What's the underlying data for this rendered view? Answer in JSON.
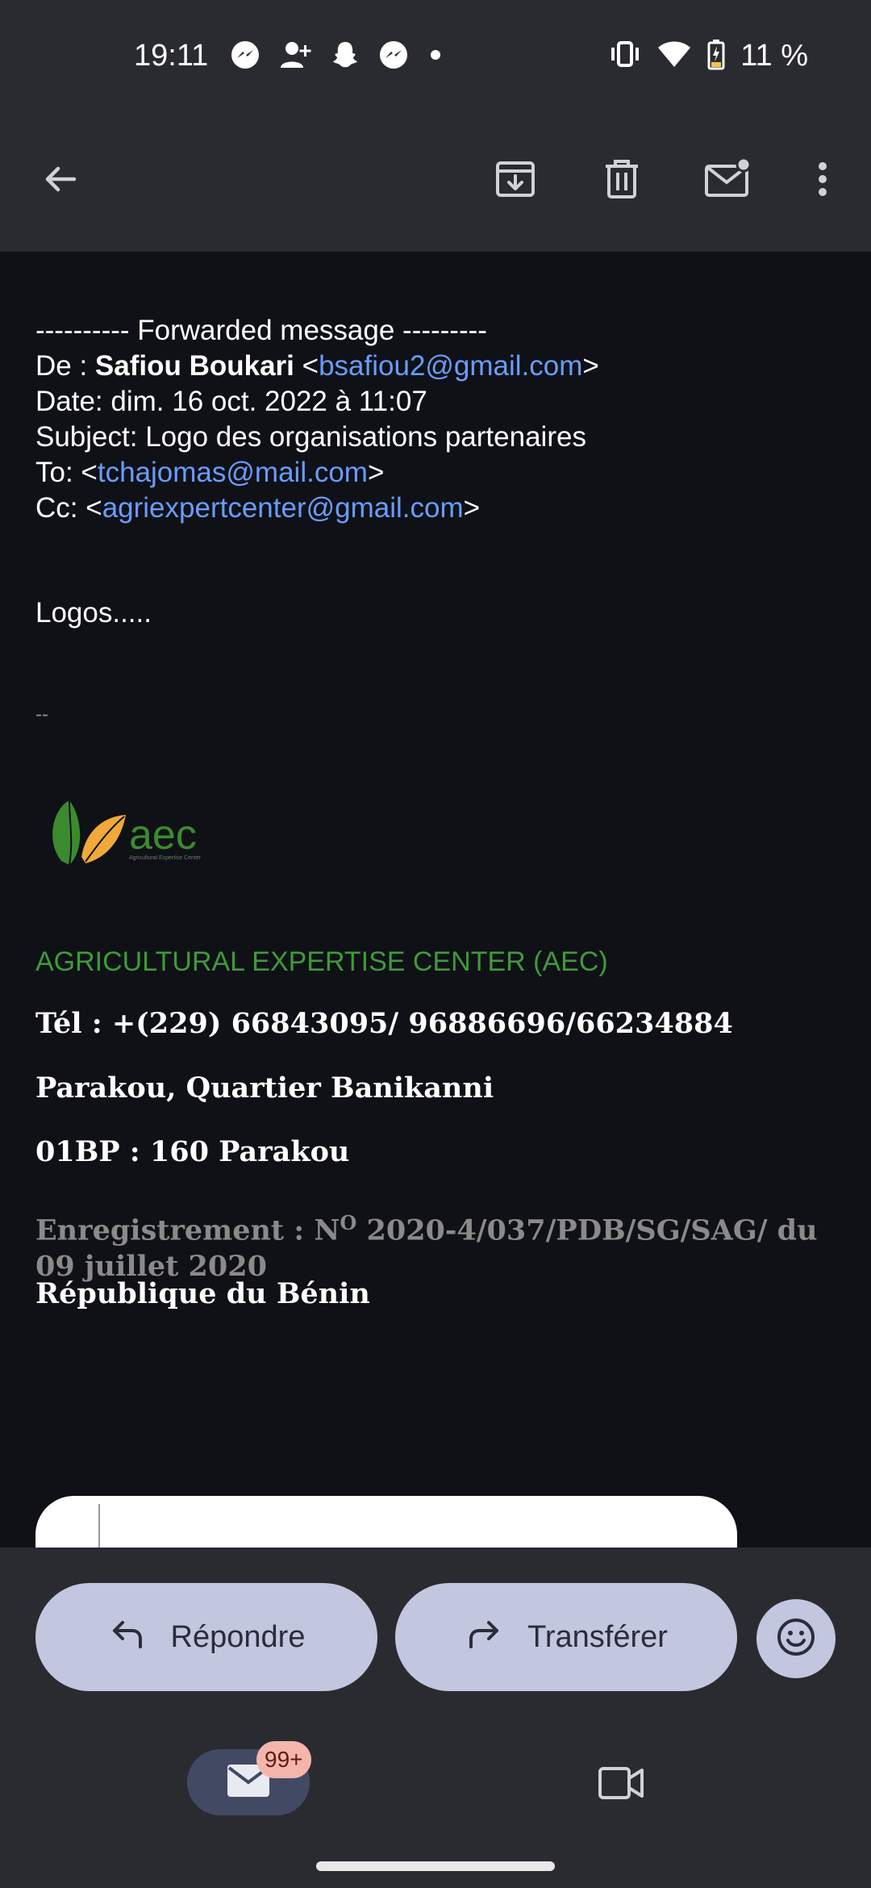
{
  "status_bar": {
    "time": "19:11",
    "battery_text": "11 %",
    "left_icons": [
      "messenger-icon",
      "add-person-icon",
      "snapchat-icon",
      "messenger-icon",
      "dot-icon"
    ],
    "right_icons": [
      "vibrate-icon",
      "wifi-icon",
      "battery-charging-icon"
    ]
  },
  "app_bar": {
    "icons": [
      "back-arrow-icon",
      "archive-icon",
      "delete-icon",
      "mark-unread-icon",
      "more-vert-icon"
    ]
  },
  "email": {
    "forward_header": "---------- Forwarded message ---------",
    "from_label": "De : ",
    "from_name": "Safiou Boukari",
    "from_email": "bsafiou2@gmail.com",
    "date_line": "Date: dim. 16 oct. 2022 à 11:07",
    "subject_line": "Subject: Logo des organisations partenaires",
    "to_label": "To: ",
    "to_email": "tchajomas@mail.com",
    "cc_label": "Cc: ",
    "cc_email": "agriexpertcenter@gmail.com",
    "body_text": "Logos.....",
    "signature_separator": "--",
    "logo": {
      "text": "aec",
      "subtext": "Agricultural Expertise Center"
    },
    "org_name": "AGRICULTURAL EXPERTISE CENTER (AEC)",
    "phone": "Tél : +(229) 66843095/ 96886696/66234884",
    "address": "Parakou, Quartier Banikanni",
    "bp": "01BP : 160 Parakou",
    "registration_prefix": "Enregistrement : N",
    "registration_sup": "O",
    "registration_rest": " 2020-4/037/PDB/SG/SAG/ du 09 juillet 2020",
    "country": "République du Bénin"
  },
  "actions": {
    "reply_label": "Répondre",
    "forward_label": "Transférer"
  },
  "bottom_nav": {
    "mail_badge": "99+"
  },
  "colors": {
    "link": "#6a9cff",
    "org_green": "#3f9a3a",
    "pill_bg": "#c2c6de",
    "bar_bg": "#2a2b30",
    "body_bg": "#0f1116"
  }
}
